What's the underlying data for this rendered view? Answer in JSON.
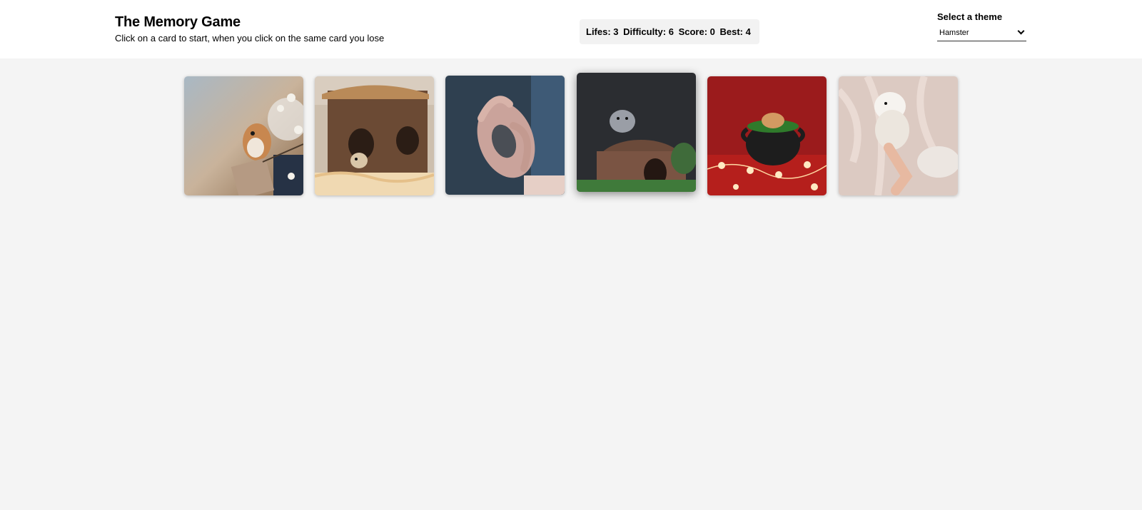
{
  "header": {
    "title": "The Memory Game",
    "subtitle": "Click on a card to start, when you click on the same card you lose"
  },
  "stats": {
    "lifes": "Lifes: 3",
    "difficulty": "Difficulty: 6",
    "score": "Score: 0",
    "best": "Best: 4"
  },
  "theme": {
    "label": "Select a theme",
    "selected": "Hamster"
  },
  "cards": [
    {
      "subject": "hamster-on-blossom-branch-photo"
    },
    {
      "subject": "hamster-in-wooden-house-photo"
    },
    {
      "subject": "hamster-in-hands-photo"
    },
    {
      "subject": "hamster-on-log-photo"
    },
    {
      "subject": "hamster-in-black-pot-photo"
    },
    {
      "subject": "white-hamster-in-hand-photo"
    }
  ]
}
